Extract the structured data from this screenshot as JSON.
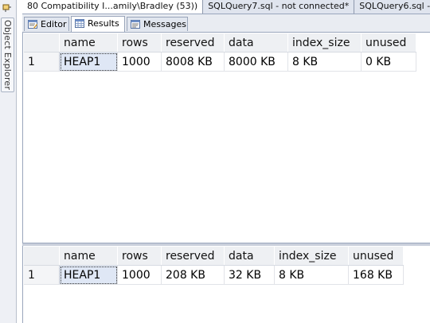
{
  "sidebar": {
    "label": "Object Explorer",
    "pin_icon": "pin-icon"
  },
  "doc_tabs": [
    {
      "label": "80 Compatibility I...amily\\Bradley (53))",
      "active": true
    },
    {
      "label": "SQLQuery7.sql - not connected*",
      "active": false
    },
    {
      "label": "SQLQuery6.sql - n",
      "active": false
    }
  ],
  "result_tabs": [
    {
      "label": "Editor",
      "icon": "editor-icon"
    },
    {
      "label": "Results",
      "icon": "grid-icon"
    },
    {
      "label": "Messages",
      "icon": "messages-icon"
    }
  ],
  "result_sets": [
    {
      "columns": [
        "name",
        "rows",
        "reserved",
        "data",
        "index_size",
        "unused"
      ],
      "rows": [
        {
          "num": "1",
          "cells": [
            "HEAP1",
            "1000",
            "8008 KB",
            "8000 KB",
            "8 KB",
            "0 KB"
          ]
        }
      ]
    },
    {
      "columns": [
        "name",
        "rows",
        "reserved",
        "data",
        "index_size",
        "unused"
      ],
      "rows": [
        {
          "num": "1",
          "cells": [
            "HEAP1",
            "1000",
            "208 KB",
            "32 KB",
            "8 KB",
            "168 KB"
          ]
        }
      ]
    }
  ]
}
